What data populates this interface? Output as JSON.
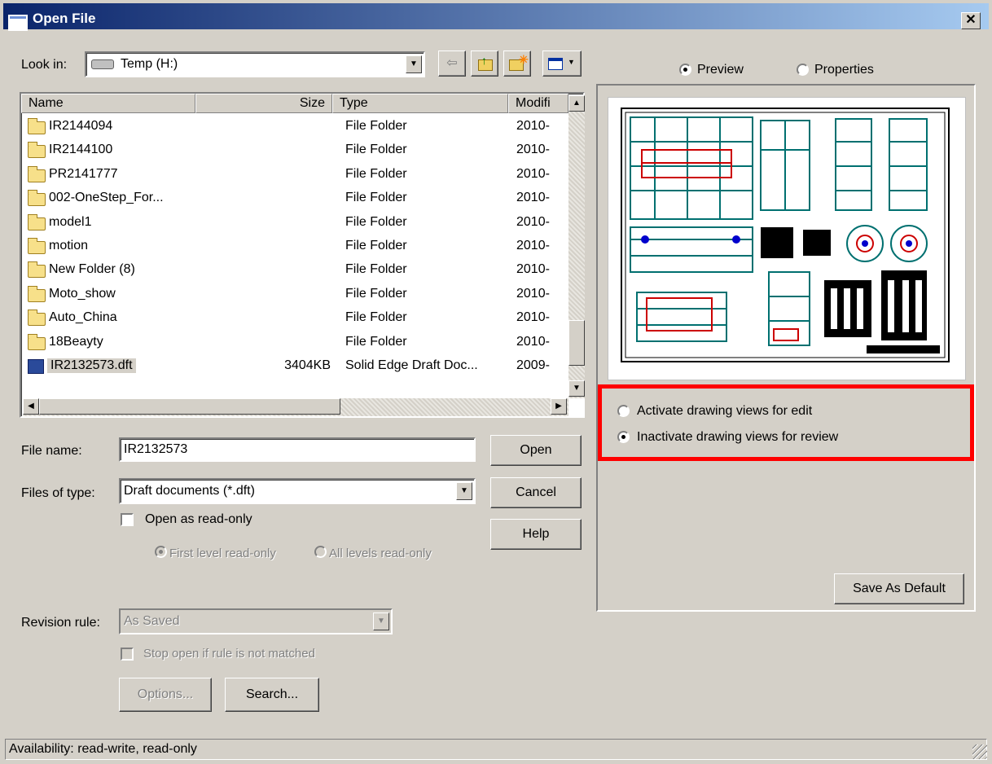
{
  "window": {
    "title": "Open File",
    "close_label": "✕"
  },
  "lookin": {
    "label": "Look in:",
    "value": "Temp (H:)"
  },
  "file_list": {
    "columns": [
      "Name",
      "Size",
      "Type",
      "Modifi"
    ],
    "rows": [
      {
        "name": "IR2144094",
        "size": "",
        "type": "File Folder",
        "modified": "2010-",
        "kind": "folder"
      },
      {
        "name": "IR2144100",
        "size": "",
        "type": "File Folder",
        "modified": "2010-",
        "kind": "folder"
      },
      {
        "name": "PR2141777",
        "size": "",
        "type": "File Folder",
        "modified": "2010-",
        "kind": "folder"
      },
      {
        "name": "002-OneStep_For...",
        "size": "",
        "type": "File Folder",
        "modified": "2010-",
        "kind": "folder"
      },
      {
        "name": "model1",
        "size": "",
        "type": "File Folder",
        "modified": "2010-",
        "kind": "folder"
      },
      {
        "name": "motion",
        "size": "",
        "type": "File Folder",
        "modified": "2010-",
        "kind": "folder"
      },
      {
        "name": "New Folder (8)",
        "size": "",
        "type": "File Folder",
        "modified": "2010-",
        "kind": "folder"
      },
      {
        "name": "Moto_show",
        "size": "",
        "type": "File Folder",
        "modified": "2010-",
        "kind": "folder"
      },
      {
        "name": "Auto_China",
        "size": "",
        "type": "File Folder",
        "modified": "2010-",
        "kind": "folder"
      },
      {
        "name": "18Beayty",
        "size": "",
        "type": "File Folder",
        "modified": "2010-",
        "kind": "folder"
      },
      {
        "name": "IR2132573.dft",
        "size": "3404KB",
        "type": "Solid Edge Draft Doc...",
        "modified": "2009-",
        "kind": "document"
      }
    ]
  },
  "form": {
    "file_name_label": "File name:",
    "file_name_value": "IR2132573",
    "files_of_type_label": "Files of type:",
    "files_of_type_value": "Draft documents (*.dft)",
    "open_readonly_label": "Open as read-only",
    "first_level_label": "First level read-only",
    "all_levels_label": "All levels read-only",
    "revision_rule_label": "Revision rule:",
    "revision_rule_value": "As Saved",
    "stop_open_label": "Stop open if rule is not matched"
  },
  "buttons": {
    "open": "Open",
    "cancel": "Cancel",
    "help": "Help",
    "options": "Options...",
    "search": "Search...",
    "save_default": "Save As Default"
  },
  "right": {
    "preview_label": "Preview",
    "properties_label": "Properties",
    "activate_label": "Activate drawing views for edit",
    "inactivate_label": "Inactivate drawing views for review",
    "selected_mode": "preview",
    "selected_view_option": "inactivate"
  },
  "status": {
    "text": "Availability: read-write, read-only"
  },
  "colors": {
    "title_start": "#0a246a",
    "title_end": "#a6caf0",
    "highlight": "#ff0000",
    "drawing_teal": "#007070",
    "drawing_red": "#cc0000"
  },
  "icons": [
    "drive-icon",
    "back-icon",
    "up-folder-icon",
    "new-folder-icon",
    "view-menu-icon",
    "folder-icon",
    "draft-document-icon"
  ]
}
